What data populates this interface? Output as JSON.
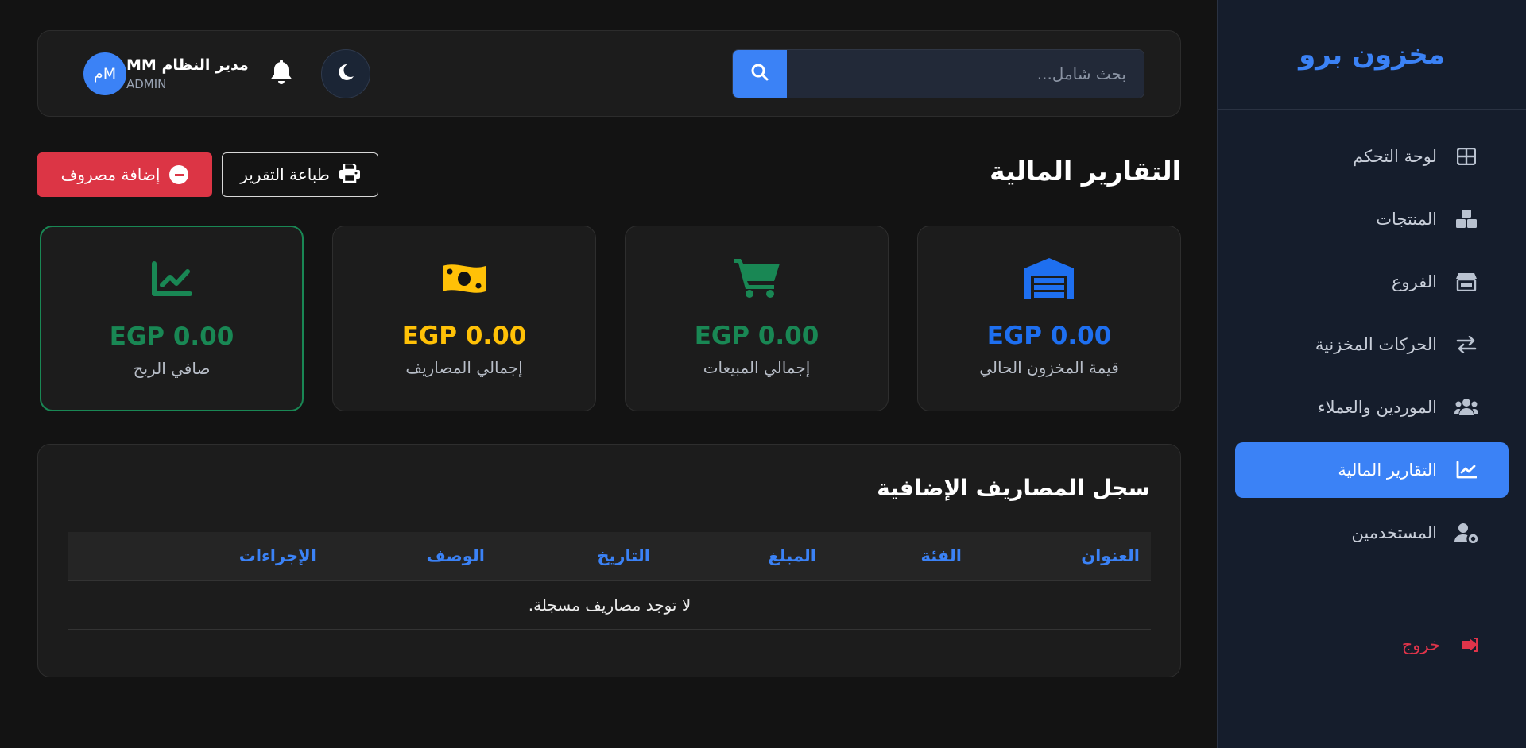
{
  "sidebar": {
    "brand": "مخزون برو",
    "items": [
      {
        "label": "لوحة التحكم",
        "icon": "dashboard-icon"
      },
      {
        "label": "المنتجات",
        "icon": "boxes-icon"
      },
      {
        "label": "الفروع",
        "icon": "store-icon"
      },
      {
        "label": "الحركات المخزنية",
        "icon": "transfer-icon"
      },
      {
        "label": "الموردين والعملاء",
        "icon": "users-icon"
      },
      {
        "label": "التقارير المالية",
        "icon": "chart-line-icon",
        "active": true
      },
      {
        "label": "المستخدمين",
        "icon": "user-gear-icon"
      }
    ],
    "logout": "خروج"
  },
  "topbar": {
    "search_placeholder": "بحث شامل...",
    "user_name": "مدير النظام MM",
    "user_role": "ADMIN",
    "avatar_initials": "Mم"
  },
  "page": {
    "title": "التقارير المالية",
    "print_button": "طباعة التقرير",
    "add_expense_button": "إضافة مصروف"
  },
  "stats": [
    {
      "label": "قيمة المخزون الحالي",
      "value": "EGP 0.00",
      "color": "#1e6ff0",
      "icon": "warehouse-icon"
    },
    {
      "label": "إجمالي المبيعات",
      "value": "EGP 0.00",
      "color": "#198754",
      "icon": "cart-icon"
    },
    {
      "label": "إجمالي المصاريف",
      "value": "EGP 0.00",
      "color": "#ffc107",
      "icon": "money-bill-icon"
    },
    {
      "label": "صافي الربح",
      "value": "EGP 0.00",
      "color": "#198754",
      "icon": "chart-line-icon"
    }
  ],
  "expenses": {
    "title": "سجل المصاريف الإضافية",
    "columns": [
      "العنوان",
      "الفئة",
      "المبلغ",
      "التاريخ",
      "الوصف",
      "الإجراءات"
    ],
    "empty_message": "لا توجد مصاريف مسجلة."
  },
  "colors": {
    "accent": "#3b82f6",
    "danger": "#dc3545",
    "success": "#198754",
    "warning": "#ffc107"
  }
}
